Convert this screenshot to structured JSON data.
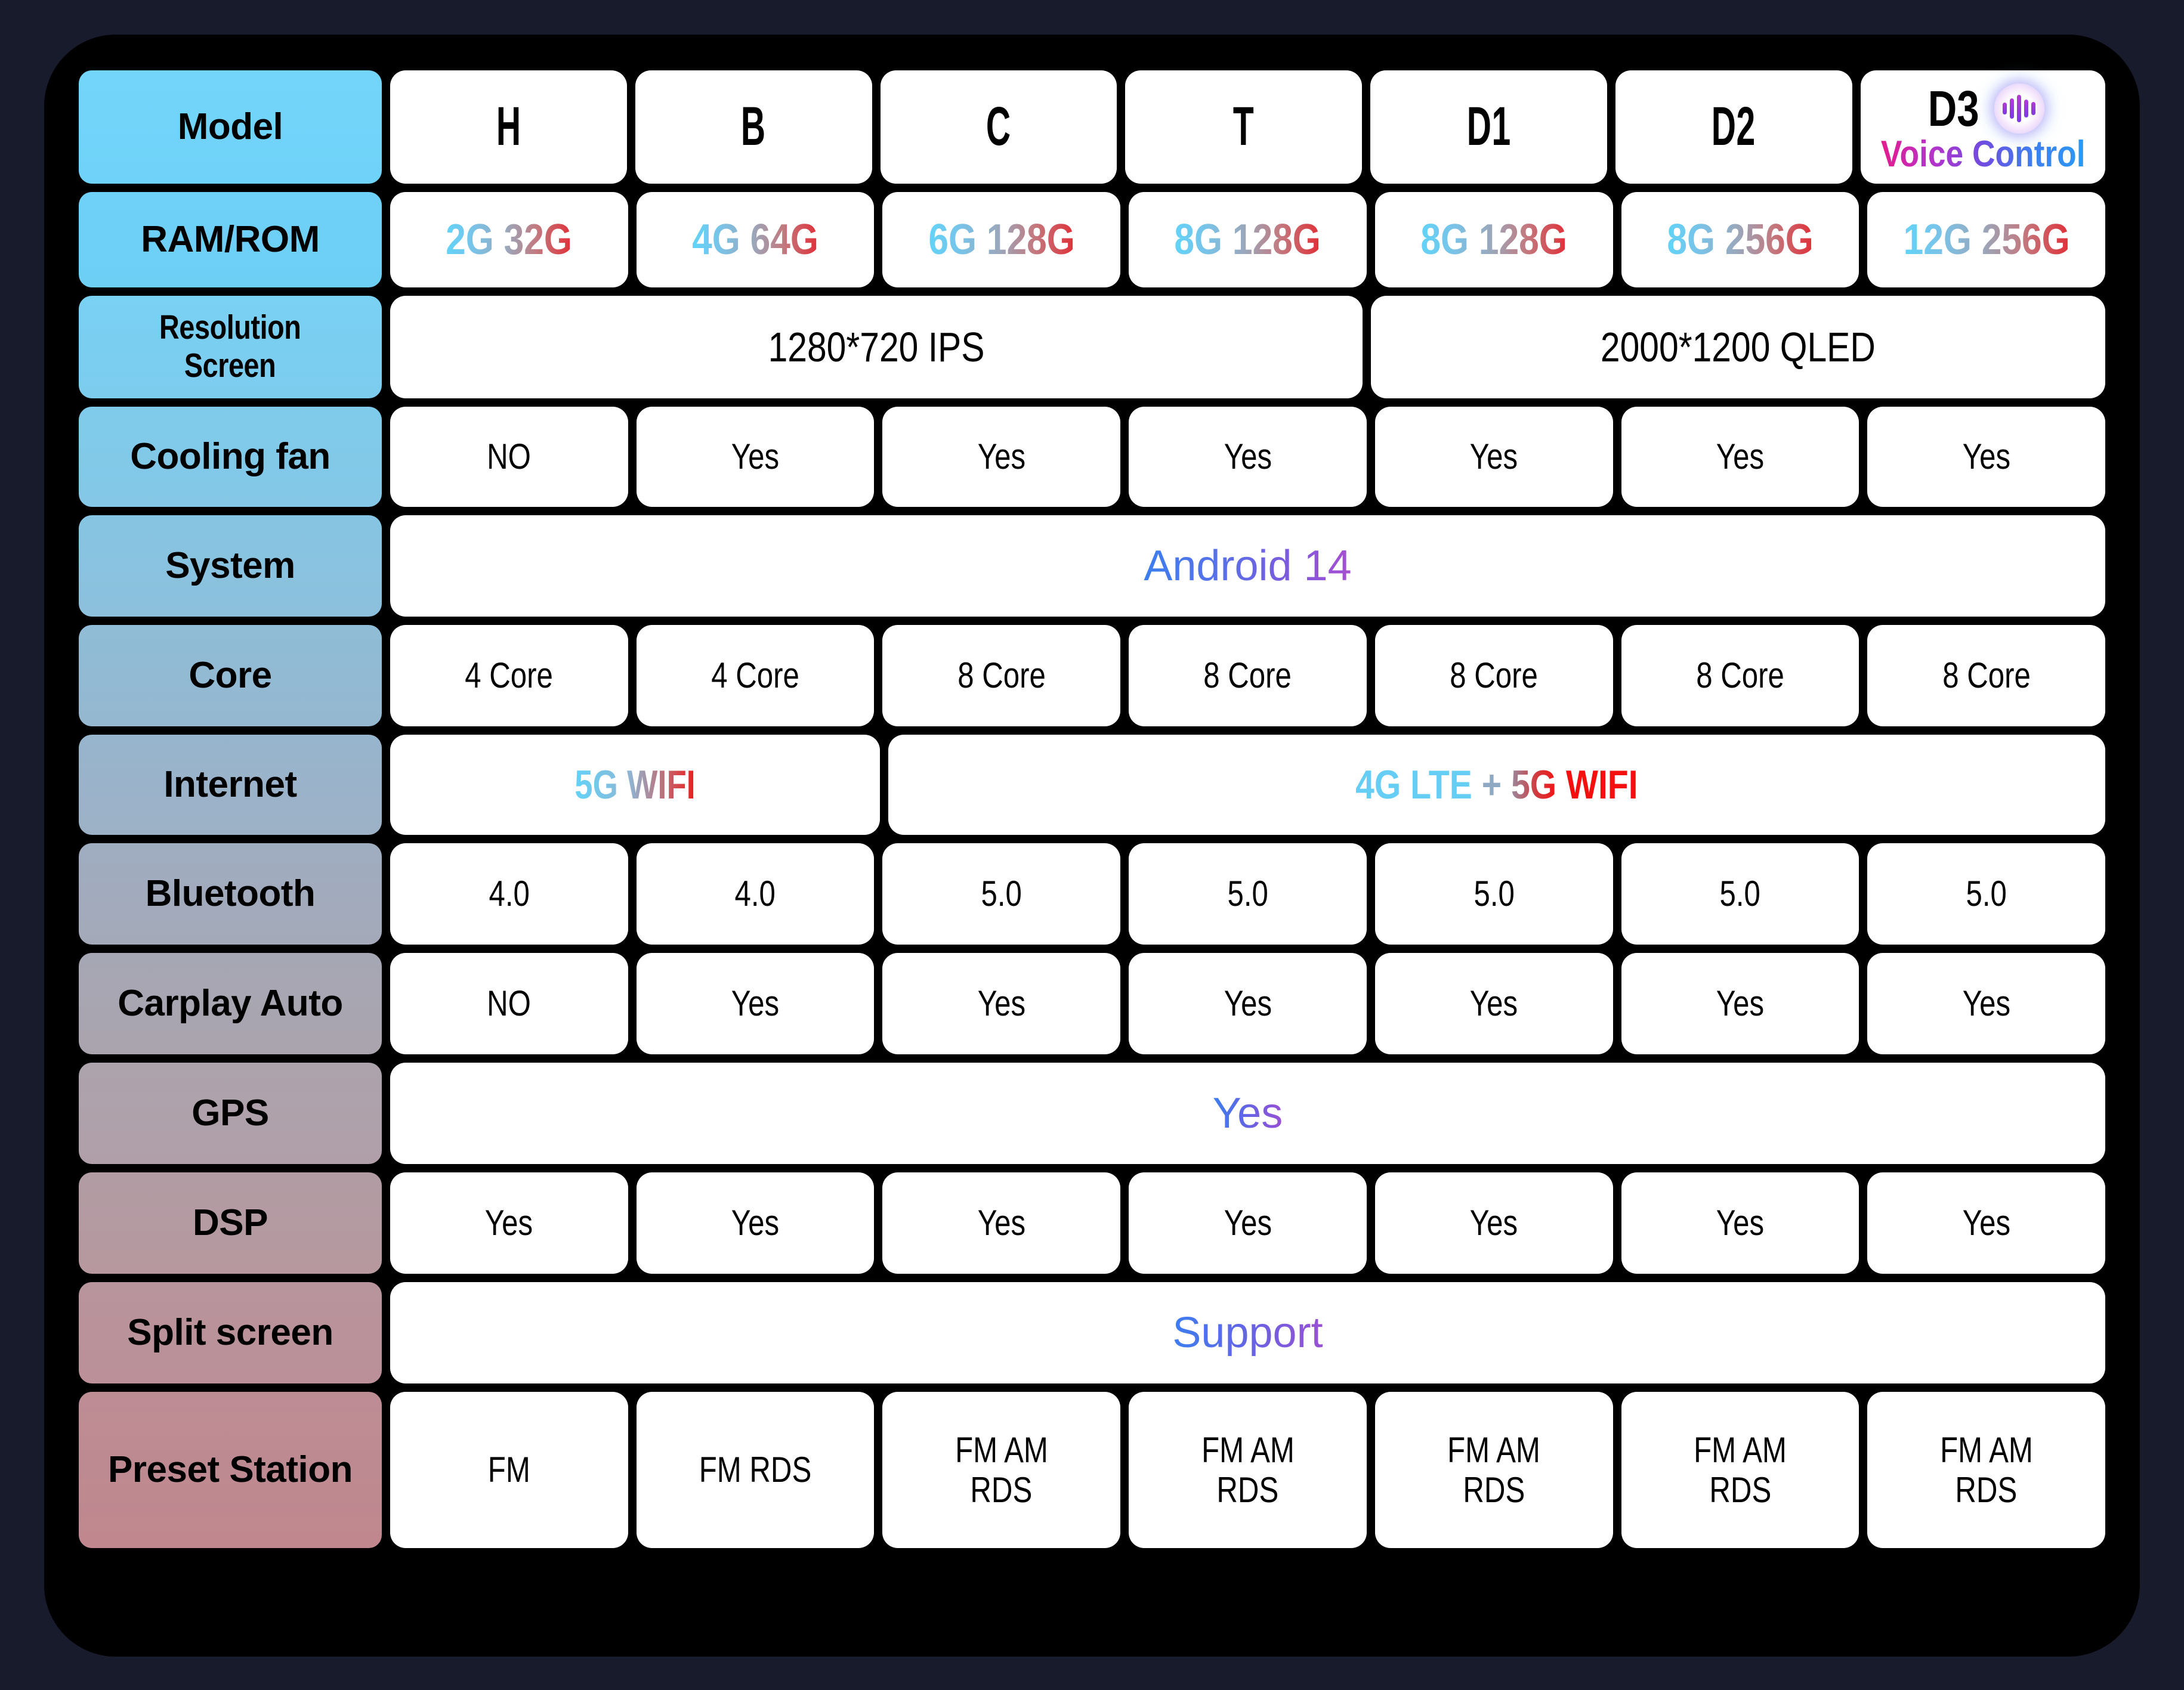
{
  "panel": {
    "background_color": "#000000",
    "page_background_color": "#171b2c"
  },
  "columns": [
    "H",
    "B",
    "C",
    "T",
    "D1",
    "D2",
    "D3"
  ],
  "rows": {
    "model": {
      "label": "Model",
      "values": [
        "H",
        "B",
        "C",
        "T",
        "D1",
        "D2"
      ],
      "d3": {
        "name": "D3",
        "icon": "voice-waveform-icon",
        "sublabel": "Voice Control"
      }
    },
    "ram_rom": {
      "label": "RAM/ROM",
      "values": [
        "2G 32G",
        "4G 64G",
        "6G 128G",
        "8G 128G",
        "8G 128G",
        "8G 256G",
        "12G 256G"
      ]
    },
    "resolution": {
      "label": "Resolution Screen",
      "label_line1": "Resolution",
      "label_line2": "Screen",
      "values": [
        "1280*720 IPS",
        "2000*1200 QLED"
      ],
      "spans": [
        4,
        3
      ]
    },
    "cooling_fan": {
      "label": "Cooling fan",
      "values": [
        "NO",
        "Yes",
        "Yes",
        "Yes",
        "Yes",
        "Yes",
        "Yes"
      ]
    },
    "system": {
      "label": "System",
      "values": [
        "Android 14"
      ],
      "spans": [
        7
      ]
    },
    "core": {
      "label": "Core",
      "values": [
        "4 Core",
        "4 Core",
        "8 Core",
        "8 Core",
        "8 Core",
        "8 Core",
        "8 Core"
      ]
    },
    "internet": {
      "label": "Internet",
      "values": [
        "5G WIFI",
        "4G LTE + 5G WIFI"
      ],
      "spans": [
        2,
        5
      ],
      "right_parts": {
        "a": "4G LTE",
        "plus": "+",
        "b": "5G",
        "c": "WIFI"
      }
    },
    "bluetooth": {
      "label": "Bluetooth",
      "values": [
        "4.0",
        "4.0",
        "5.0",
        "5.0",
        "5.0",
        "5.0",
        "5.0"
      ]
    },
    "carplay_auto": {
      "label": "Carplay Auto",
      "values": [
        "NO",
        "Yes",
        "Yes",
        "Yes",
        "Yes",
        "Yes",
        "Yes"
      ]
    },
    "gps": {
      "label": "GPS",
      "values": [
        "Yes"
      ],
      "spans": [
        7
      ]
    },
    "dsp": {
      "label": "DSP",
      "values": [
        "Yes",
        "Yes",
        "Yes",
        "Yes",
        "Yes",
        "Yes",
        "Yes"
      ]
    },
    "split_screen": {
      "label": "Split screen",
      "values": [
        "Support"
      ],
      "spans": [
        7
      ]
    },
    "preset_station": {
      "label": "Preset Station",
      "values": [
        {
          "line1": "FM",
          "line2": ""
        },
        {
          "line1": "FM RDS",
          "line2": ""
        },
        {
          "line1": "FM AM",
          "line2": "RDS"
        },
        {
          "line1": "FM AM",
          "line2": "RDS"
        },
        {
          "line1": "FM AM",
          "line2": "RDS"
        },
        {
          "line1": "FM AM",
          "line2": "RDS"
        },
        {
          "line1": "FM AM",
          "line2": "RDS"
        }
      ]
    }
  },
  "colors": {
    "label_start": "#74d5fa",
    "label_end": "#c0878e",
    "ram_gradient_start": "#62d3f8",
    "ram_gradient_end": "#e03038",
    "android_gradient_start": "#3c7ef0",
    "android_gradient_end": "#a84fd0",
    "wifi_red": "#f50f0f",
    "lte_cyan": "#66cdf5",
    "voice_gradient_start": "#e61a8c",
    "voice_gradient_end": "#2a9bf5"
  }
}
